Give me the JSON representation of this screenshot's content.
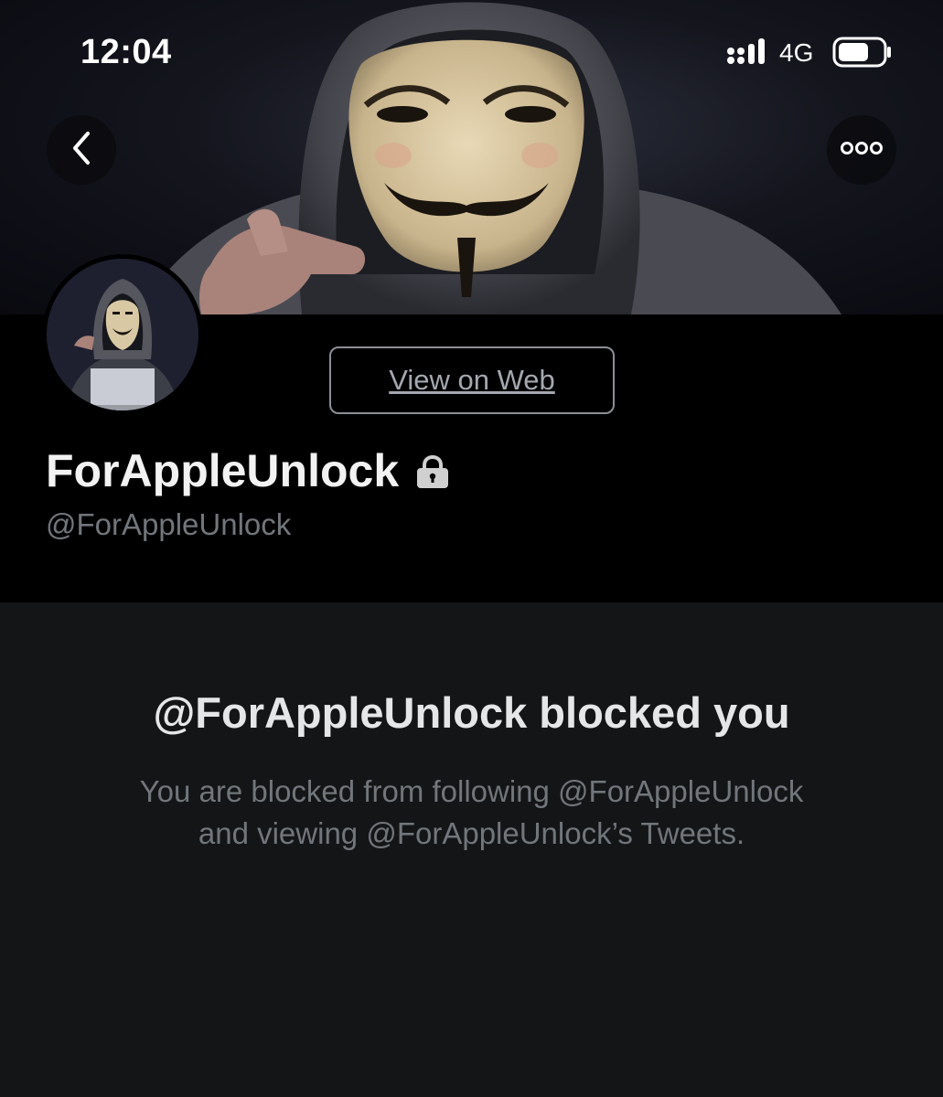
{
  "status_bar": {
    "time": "12:04",
    "network": "4G",
    "signal_icon": "signal-bars-icon",
    "battery_icon": "battery-icon"
  },
  "header": {
    "back_icon": "chevron-left-icon",
    "more_icon": "more-horizontal-icon",
    "banner_image": "anonymous-mask-hooded-figure"
  },
  "profile": {
    "avatar_image": "hooded-mask-figure-with-laptop",
    "view_on_web_label": "View on Web",
    "display_name": "ForAppleUnlock",
    "protected_icon": "lock-icon",
    "handle": "@ForAppleUnlock"
  },
  "blocked": {
    "title": "@ForAppleUnlock blocked you",
    "description_line1": "You are blocked from following @ForAppleUnlock",
    "description_line2": "and viewing @ForAppleUnlock’s Tweets."
  },
  "colors": {
    "profile_bg": "#000000",
    "page_bg": "#141517",
    "secondary_text": "#71767b",
    "primary_text": "#e7e9ea"
  }
}
